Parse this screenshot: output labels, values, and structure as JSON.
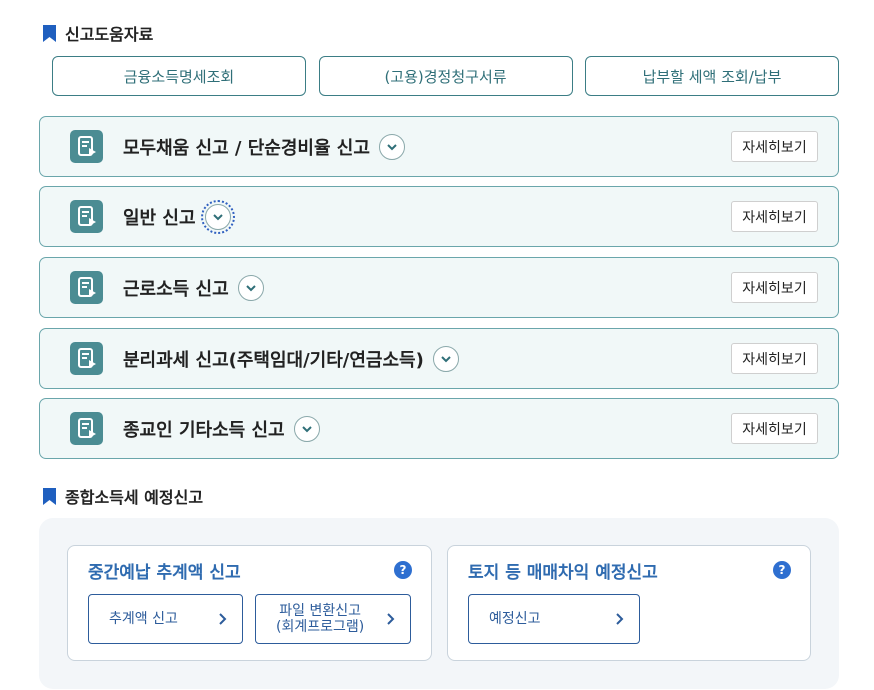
{
  "section1": {
    "title": "신고도움자료"
  },
  "help_buttons": [
    {
      "label": "금융소득명세조회"
    },
    {
      "label": "(고용)경정청구서류"
    },
    {
      "label": "납부할 세액 조회/납부"
    }
  ],
  "accordions": [
    {
      "title": "모두채움 신고 / 단순경비율 신고",
      "detail": "자세히보기"
    },
    {
      "title": "일반 신고",
      "detail": "자세히보기"
    },
    {
      "title": "근로소득 신고",
      "detail": "자세히보기"
    },
    {
      "title": "분리과세 신고(주택임대/기타/연금소득)",
      "detail": "자세히보기"
    },
    {
      "title": "종교인 기타소득 신고",
      "detail": "자세히보기"
    }
  ],
  "section2": {
    "title": "종합소득세 예정신고"
  },
  "cards": [
    {
      "title": "중간예납 추계액 신고",
      "help": "?",
      "buttons": [
        {
          "line1": "추계액 신고",
          "line2": ""
        },
        {
          "line1": "파일 변환신고",
          "line2": "(회계프로그램)"
        }
      ]
    },
    {
      "title": "토지 등 매매차익 예정신고",
      "help": "?",
      "buttons": [
        {
          "line1": "예정신고",
          "line2": ""
        }
      ]
    }
  ],
  "colors": {
    "teal": "#3b7d85",
    "accordion_bg": "#f1f8f8",
    "blue": "#2e6fd0",
    "navy": "#2d5c9b"
  },
  "icons": {
    "bookmark": "bookmark-icon",
    "document": "document-submit-icon",
    "chevron": "chevron-down-icon",
    "arrow": "chevron-right-icon",
    "help": "help-icon"
  }
}
